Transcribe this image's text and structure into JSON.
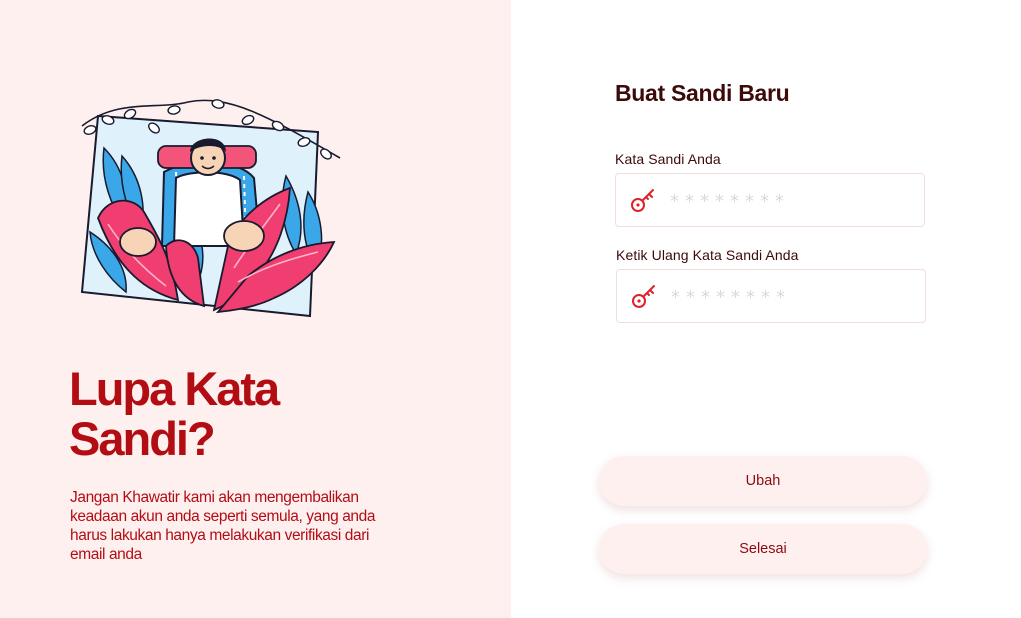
{
  "hero": {
    "title_line1": "Lupa Kata",
    "title_line2": "Sandi?",
    "subtitle": "Jangan Khawatir kami akan mengembalikan keadaan akun anda seperti semula, yang anda harus lakukan hanya melakukan verifikasi dari email anda"
  },
  "illustration": {
    "description_icon": "person-relaxing-with-plants-illustration"
  },
  "form": {
    "title": "Buat Sandi Baru",
    "password_label": "Kata Sandi Anda",
    "password_placeholder": "********",
    "password_icon": "key-icon",
    "confirm_label": "Ketik Ulang Kata Sandi Anda",
    "confirm_placeholder": "********",
    "confirm_icon": "key-icon"
  },
  "buttons": {
    "change_label": "Ubah",
    "done_label": "Selesai"
  },
  "colors": {
    "accent": "#b30d14",
    "left_panel_bg": "#fff0f0",
    "title_dark": "#3d0a0a",
    "button_bg": "#fff0f0",
    "key_icon": "#e0202a"
  }
}
